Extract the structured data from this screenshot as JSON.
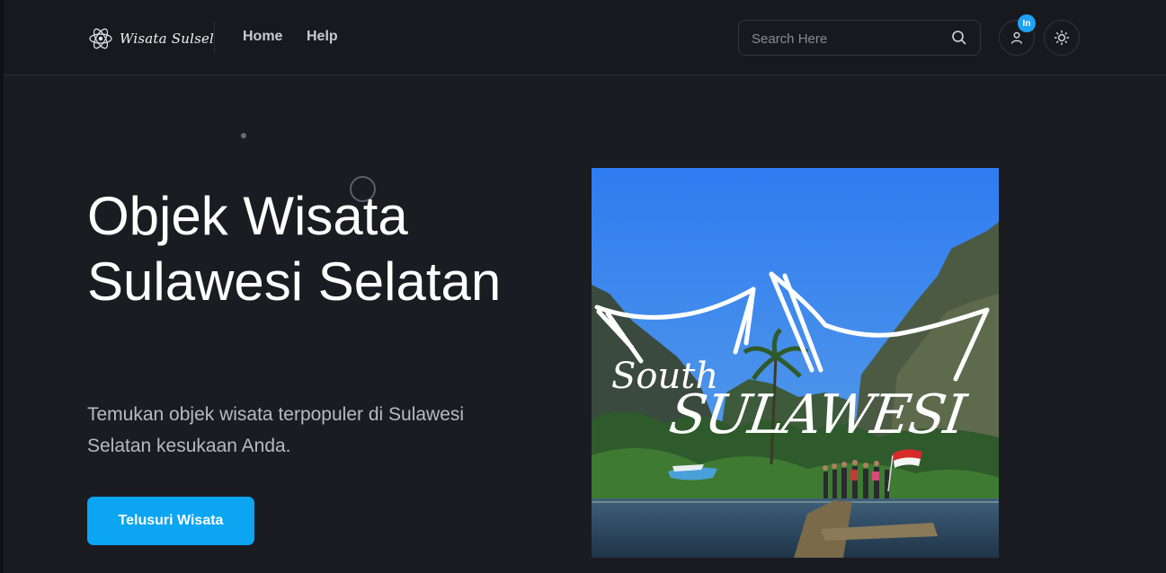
{
  "brand": {
    "name": "Wisata Sulsel",
    "logo_icon": "atom-logo-icon"
  },
  "nav": {
    "links": [
      {
        "label": "Home"
      },
      {
        "label": "Help"
      }
    ]
  },
  "search": {
    "placeholder": "Search Here",
    "value": "",
    "icon": "search-icon"
  },
  "user_menu": {
    "badge_text": "In",
    "icon": "user-icon",
    "badge_color": "#1da1f2"
  },
  "theme_toggle": {
    "icon": "sun-icon"
  },
  "hero": {
    "title": "Objek Wisata Sulawesi Selatan",
    "subtitle": "Temukan objek wisata terpopuler di Sulawesi Selatan kesukaan Anda.",
    "cta_label": "Telusuri Wisata",
    "image": {
      "overlay_line1": "South",
      "overlay_line2": "SULAWESI"
    }
  },
  "colors": {
    "background": "#1b1b22",
    "header": "#18181f",
    "accent": "#0ba5f2"
  }
}
